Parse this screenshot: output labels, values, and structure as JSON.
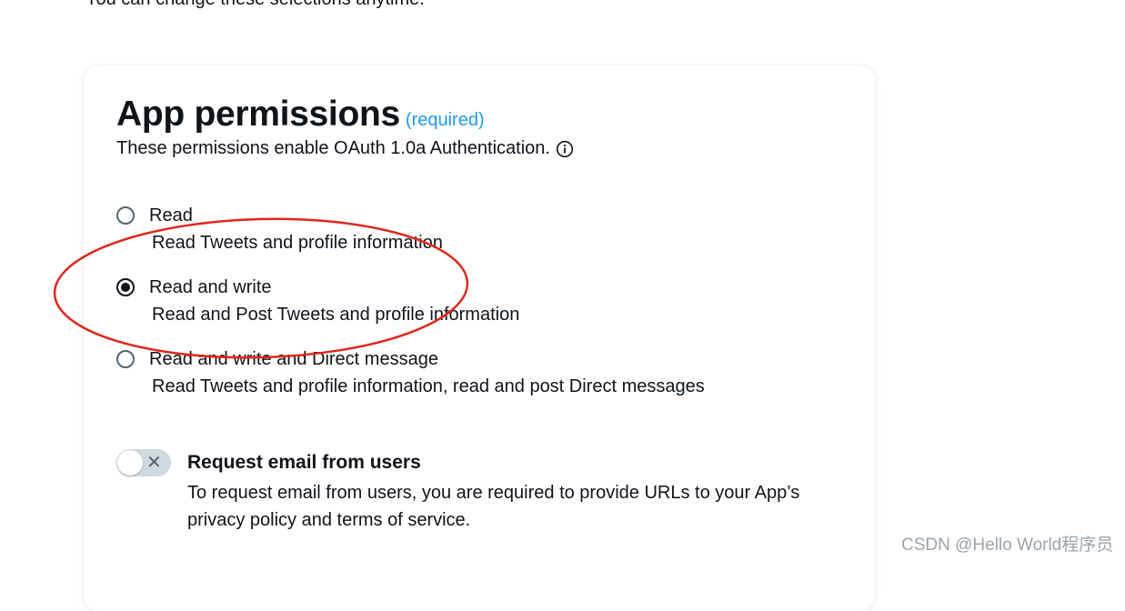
{
  "top_text": "You can change these selections anytime.",
  "card": {
    "title": "App permissions",
    "required": "(required)",
    "subtitle": "These permissions enable OAuth 1.0a Authentication.",
    "options": [
      {
        "label": "Read",
        "description": "Read Tweets and profile information",
        "checked": false
      },
      {
        "label": "Read and write",
        "description": "Read and Post Tweets and profile information",
        "checked": true
      },
      {
        "label": "Read and write and Direct message",
        "description": "Read Tweets and profile information, read and post Direct messages",
        "checked": false
      }
    ],
    "email_toggle": {
      "label": "Request email from users",
      "description": "To request email from users, you are required to provide URLs to your App’s privacy policy and terms of service.",
      "enabled": false
    }
  },
  "annotation": {
    "color": "#e0261b"
  },
  "watermark": "CSDN @Hello World程序员",
  "colors": {
    "accent": "#1d9bf0",
    "text": "#0f1419",
    "muted": "#536471"
  }
}
